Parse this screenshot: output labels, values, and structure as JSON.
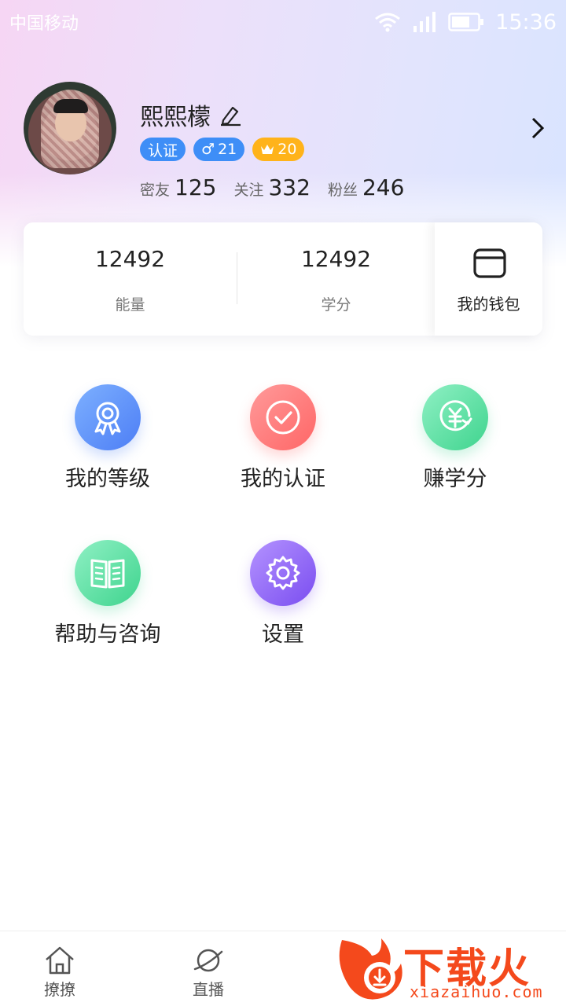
{
  "status_bar": {
    "carrier": "中国移动",
    "time": "15:36"
  },
  "profile": {
    "username": "熙熙檬",
    "badges": {
      "verify": "认证",
      "gender_symbol": "♂",
      "age": "21",
      "vip_level": "20"
    },
    "stats": [
      {
        "label": "密友",
        "value": "125"
      },
      {
        "label": "关注",
        "value": "332"
      },
      {
        "label": "粉丝",
        "value": "246"
      }
    ]
  },
  "assets_card": {
    "energy": {
      "value": "12492",
      "label": "能量"
    },
    "credits": {
      "value": "12492",
      "label": "学分"
    },
    "wallet_label": "我的钱包"
  },
  "menu": [
    {
      "label": "我的等级",
      "icon": "medal-icon"
    },
    {
      "label": "我的认证",
      "icon": "check-circle-icon"
    },
    {
      "label": "赚学分",
      "icon": "yuan-coin-icon"
    },
    {
      "label": "帮助与咨询",
      "icon": "book-icon"
    },
    {
      "label": "设置",
      "icon": "gear-icon"
    }
  ],
  "bottom_nav": [
    {
      "label": "撩撩",
      "icon": "home-icon"
    },
    {
      "label": "直播",
      "icon": "planet-icon"
    }
  ],
  "watermark": {
    "text": "下载火",
    "url": "xiazaihuo.com"
  },
  "colors": {
    "accent_blue": "#3e8ef7",
    "vip_gold": "#ffb31a",
    "watermark_orange": "#f4491c"
  }
}
